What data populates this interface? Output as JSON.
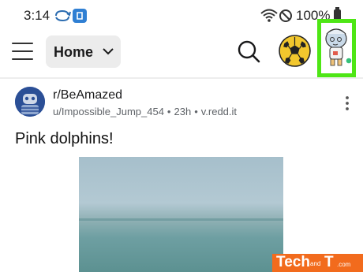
{
  "status_bar": {
    "time": "3:14",
    "battery_percent": "100%",
    "icons": [
      "sync-icon",
      "app-notification-icon",
      "wifi-icon",
      "do-not-disturb-icon",
      "battery-icon"
    ]
  },
  "header": {
    "feed_label": "Home",
    "icons": [
      "menu-icon",
      "chevron-down-icon",
      "search-icon",
      "soccer-ball-icon",
      "user-avatar-icon"
    ],
    "avatar_online": true,
    "highlight_color": "#4ee615"
  },
  "post": {
    "community": "r/BeAmazed",
    "author": "u/Impossible_Jump_454",
    "age": "23h",
    "domain": "v.redd.it",
    "separator": "•",
    "title": "Pink dolphins!",
    "icons": [
      "community-avatar-icon",
      "more-options-icon"
    ]
  },
  "watermark": {
    "brand_colors": {
      "background": "#f26b1d",
      "text": "#ffffff"
    },
    "parts": [
      "Tech",
      "and",
      "T",
      ".com"
    ]
  }
}
